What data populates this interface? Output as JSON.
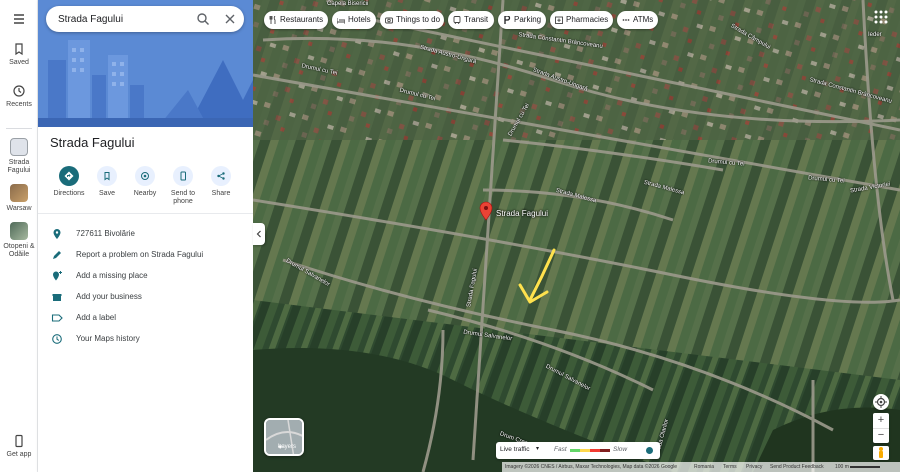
{
  "rail": {
    "saved": "Saved",
    "recents": "Recents",
    "recent_places": [
      {
        "label": "Strada Fagului"
      },
      {
        "label": "Warsaw"
      },
      {
        "label": "Otopeni & Odăile"
      }
    ],
    "get_app": "Get app"
  },
  "search": {
    "value": "Strada Fagului"
  },
  "place": {
    "title": "Strada Fagului",
    "actions": [
      "Directions",
      "Save",
      "Nearby",
      "Send to phone",
      "Share"
    ],
    "rows": [
      "727611 Bivolărie",
      "Report a problem on Strada Fagului",
      "Add a missing place",
      "Add your business",
      "Add a label",
      "Your Maps history"
    ]
  },
  "chips": [
    "Restaurants",
    "Hotels",
    "Things to do",
    "Transit",
    "Parking",
    "Pharmacies",
    "ATMs"
  ],
  "map": {
    "pin_label": "Strada Fagului",
    "street_labels": [
      "Capela Bisericii",
      "Strada Constantin Brâncoveanu",
      "Strada Câmpului",
      "Strada Austro-Ungară",
      "Strada Austro-Ungară",
      "Strada Constantin Brâncoveanu",
      "Drumul cu Tei",
      "Drumul cu Tei",
      "Drumul cu Tei",
      "Drumul cu Tei",
      "Drumul cu Tei",
      "Strada Malessa",
      "Strada Malessa",
      "Strada Victoriei",
      "Drumul Salvanelor",
      "Drumul Salvanelor",
      "Drumul Salvanelor",
      "Strada Fagului",
      "Drum Crea",
      "Strada Olarilor",
      "Ieder"
    ],
    "layers_label": "Layers",
    "traffic": {
      "label": "Live traffic",
      "fast": "Fast",
      "slow": "Slow"
    },
    "footer": [
      "Imagery ©2026 CNES / Airbus, Maxar Technologies, Map data ©2026 Google",
      "Romania",
      "Terms",
      "Privacy",
      "Send Product Feedback",
      "100 m"
    ]
  },
  "colors": {
    "accent": "#1a6c7a",
    "pin": "#ea4335",
    "hero": "#5e8dd6",
    "arrow": "#ffe14d"
  }
}
